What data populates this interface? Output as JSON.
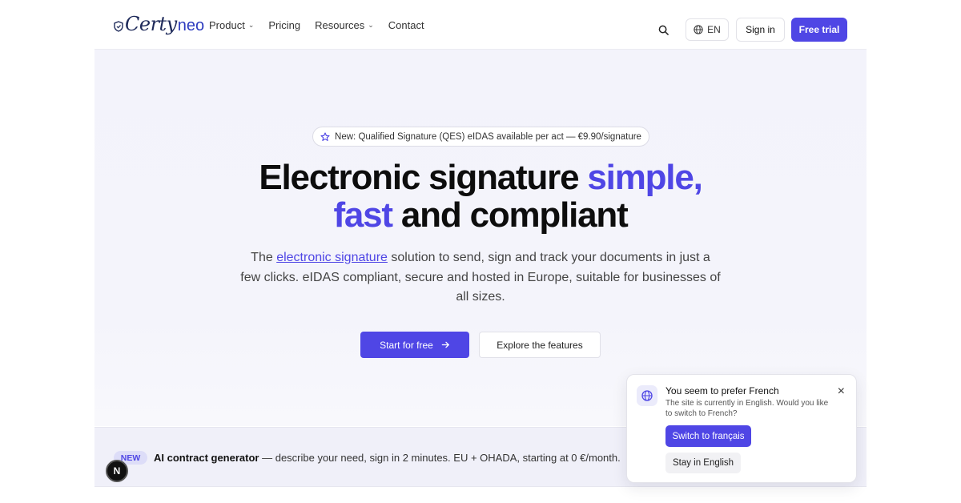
{
  "brand": {
    "logo_main": "Certy",
    "logo_suffix": "neo",
    "accent_color": "#4f46e5",
    "logo_color": "#1e2a5a"
  },
  "nav": {
    "items": [
      {
        "label": "Product",
        "has_dropdown": true
      },
      {
        "label": "Pricing",
        "has_dropdown": false
      },
      {
        "label": "Resources",
        "has_dropdown": true
      },
      {
        "label": "Contact",
        "has_dropdown": false
      }
    ],
    "chevron_icon": "chevron-down-icon"
  },
  "header": {
    "search_icon": "search-icon",
    "language_icon": "globe-icon",
    "language_label": "EN",
    "signin_label": "Sign in",
    "trial_label": "Free trial"
  },
  "hero": {
    "announcement": "New: Qualified Signature (QES) eIDAS available per act — €9.90/signature",
    "announcement_icon": "star-icon",
    "title_part1": "Electronic signature ",
    "title_accent1": "simple,",
    "title_accent2": "fast",
    "title_part2": " and compliant",
    "subtitle_before": "The ",
    "subtitle_link": "electronic signature",
    "subtitle_after": " solution to send, sign and track your documents in just a few clicks. eIDAS compliant, secure and hosted in Europe, suitable for businesses of all sizes.",
    "cta_primary": "Start for free",
    "cta_primary_icon": "arrow-right-icon",
    "cta_secondary": "Explore the features"
  },
  "strip": {
    "badge": "NEW",
    "highlight": "AI contract generator",
    "text": " — describe your need, sign in 2 minutes. EU + OHADA, starting at 0 €/month.",
    "avatar_letter": "N"
  },
  "popup": {
    "icon": "globe-icon",
    "title": "You seem to prefer French",
    "body": "The site is currently in English. Would you like to switch to French?",
    "switch_label": "Switch to français",
    "stay_label": "Stay in English",
    "close_icon": "close-icon",
    "close_glyph": "×"
  }
}
